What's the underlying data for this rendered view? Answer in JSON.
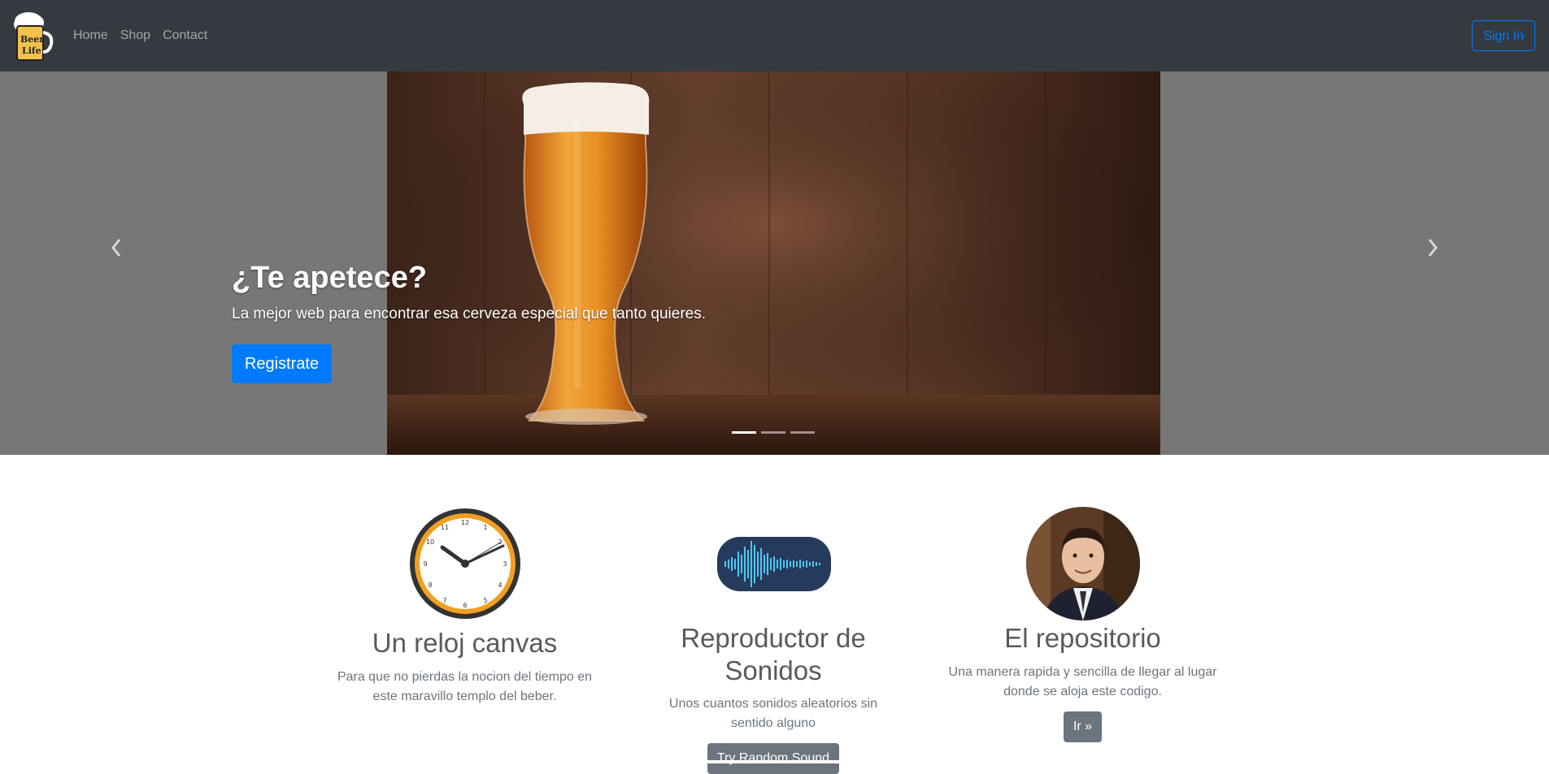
{
  "nav": {
    "links": [
      "Home",
      "Shop",
      "Contact"
    ],
    "signin": "Sign In",
    "logo_icon": "beer-mug-logo-icon"
  },
  "carousel": {
    "title": "¿Te apetece?",
    "subtitle": "La mejor web para encontrar esa cerveza especial que tanto quieres.",
    "button": "Registrate",
    "slides_count": 3,
    "active_slide": 1
  },
  "features": [
    {
      "icon": "clock-icon",
      "title": "Un reloj canvas",
      "text": "Para que no pierdas la nocion del tiempo en este maravillo templo del beber."
    },
    {
      "icon": "soundwave-icon",
      "title": "Reproductor de Sonidos",
      "text": "Unos cuantos sonidos aleatorios sin sentido alguno",
      "button": "Try Random Sound"
    },
    {
      "icon": "avatar",
      "title": "El repositorio",
      "text": "Una manera rapida y sencilla de llegar al lugar donde se aloja este codigo.",
      "button": "Ir »"
    }
  ],
  "colors": {
    "navbar": "#343a40",
    "primary": "#007bff",
    "secondary": "#6c757d",
    "carousel_bg": "#777777"
  }
}
